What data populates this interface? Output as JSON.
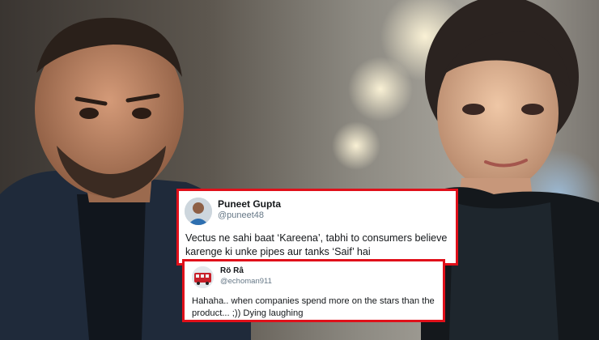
{
  "tweets": [
    {
      "name": "Puneet Gupta",
      "handle": "@puneet48",
      "text": "Vectus ne sahi baat ‘Kareena’, tabhi to consumers believe karenge ki unke pipes aur tanks ‘Saif’ hai"
    },
    {
      "name": "Rö Râ",
      "handle": "@echoman911",
      "text": "Hahaha.. when companies spend more on the stars than the product... ;)) Dying laughing"
    }
  ],
  "colors": {
    "highlight_border": "#e0101a",
    "tweet_background": "#ffffff",
    "handle_gray": "#657786"
  }
}
